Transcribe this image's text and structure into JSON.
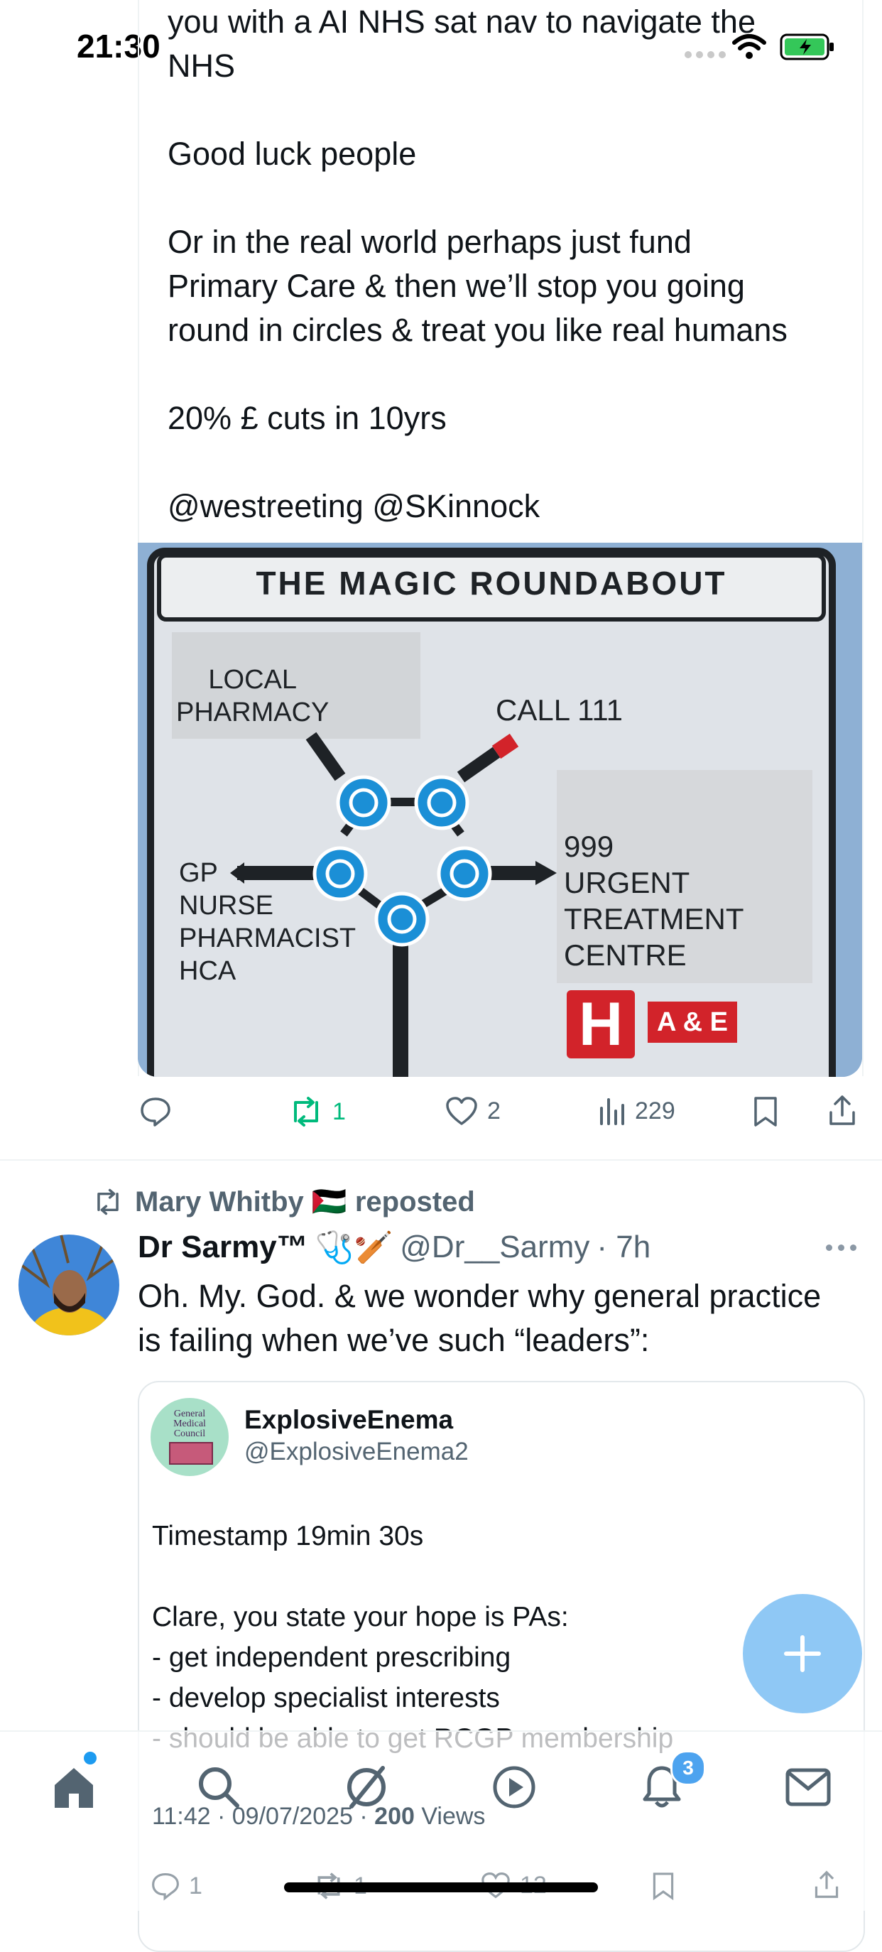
{
  "status_bar": {
    "time": "21:30"
  },
  "tweet1": {
    "text": "you with a AI NHS sat nav to navigate the\nNHS\n\nGood luck people\n\nOr in the real world perhaps just fund\nPrimary Care & then we’ll stop you going\nround in circles & treat you like real humans\n\n20% £ cuts in 10yrs\n\n@westreeting @SKinnock",
    "image": {
      "title": "THE MAGIC ROUNDABOUT",
      "label_pharmacy": "LOCAL\nPHARMACY",
      "label_call": "CALL 111",
      "label_gp": "GP\nNURSE\nPHARMACIST\nHCA",
      "label_urgent": "999\nURGENT\nTREATMENT\nCENTRE",
      "hospital_letter": "H",
      "ae_label": "A & E"
    },
    "actions": {
      "reposts": "1",
      "likes": "2",
      "views": "229"
    }
  },
  "tweet2": {
    "repost_label": "Mary Whitby 🇵🇸 reposted",
    "author_name": "Dr Sarmy™",
    "author_emoji": "🩺🏏",
    "author_handle": "@Dr__Sarmy",
    "time": "· 7h",
    "text": "Oh. My. God. & we wonder why general practice\nis failing when we’ve such “leaders”:",
    "quote": {
      "name": "ExplosiveEnema",
      "handle": "@ExplosiveEnema2",
      "avatar_text": "General\nMedical\nCouncil",
      "text": "Timestamp 19min 30s\n\nClare, you state your hope is PAs:\n- get independent prescribing\n- develop specialist interests\n- should be able to get RCGP membership",
      "meta_time": "11:42 · 09/07/2025 · ",
      "meta_views_count": "200",
      "meta_views_label": " Views",
      "replies": "1",
      "reposts": "1",
      "likes": "12"
    }
  },
  "nav": {
    "notification_count": "3"
  },
  "colors": {
    "accent": "#1d9bf0",
    "repost_green": "#00ba7c",
    "muted": "#536471"
  }
}
